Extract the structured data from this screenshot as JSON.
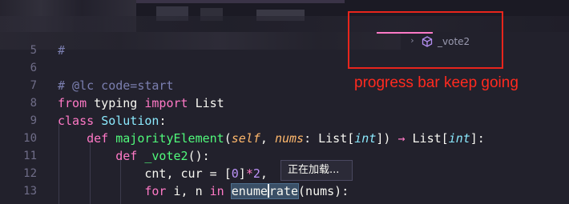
{
  "breadcrumb": {
    "symbol": "_vote2",
    "chevron": "›",
    "icon": "cube-icon"
  },
  "annotation": {
    "text": "progress bar keep going"
  },
  "tooltip": {
    "text": "正在加载..."
  },
  "editor": {
    "line_numbers": [
      "5",
      "6",
      "7",
      "8",
      "9",
      "10",
      "11",
      "12",
      "13"
    ],
    "lines": {
      "l5": "#",
      "l7": "# @lc code=start",
      "l8_kw1": "from",
      "l8_mod": " typing ",
      "l8_kw2": "import",
      "l8_name": " List",
      "l9_kw": "class",
      "l9_cls": "Solution",
      "l9_colon": ":",
      "l10_kw": "def",
      "l10_fn": "majorityElement",
      "l10_open": "(",
      "l10_self": "self",
      "l10_comma": ", ",
      "l10_nums": "nums",
      "l10_colon": ": List[",
      "l10_int": "int",
      "l10_close": "]) ",
      "l10_arrow": "→",
      "l10_ret": " List[",
      "l10_int2": "int",
      "l10_end": "]:",
      "l11_kw": "def",
      "l11_fn": "_vote2",
      "l11_rest": "():",
      "l12_a": "cnt, cur = [",
      "l12_zero": "0",
      "l12_b": "]",
      "l12_star": "*",
      "l12_two": "2",
      "l12_c": ",",
      "l13_kw1": "for",
      "l13_a": " i, n ",
      "l13_kw2": "in",
      "l13_enum1": "enume",
      "l13_enum2": "rate",
      "l13_rest": "(nums):"
    }
  }
}
